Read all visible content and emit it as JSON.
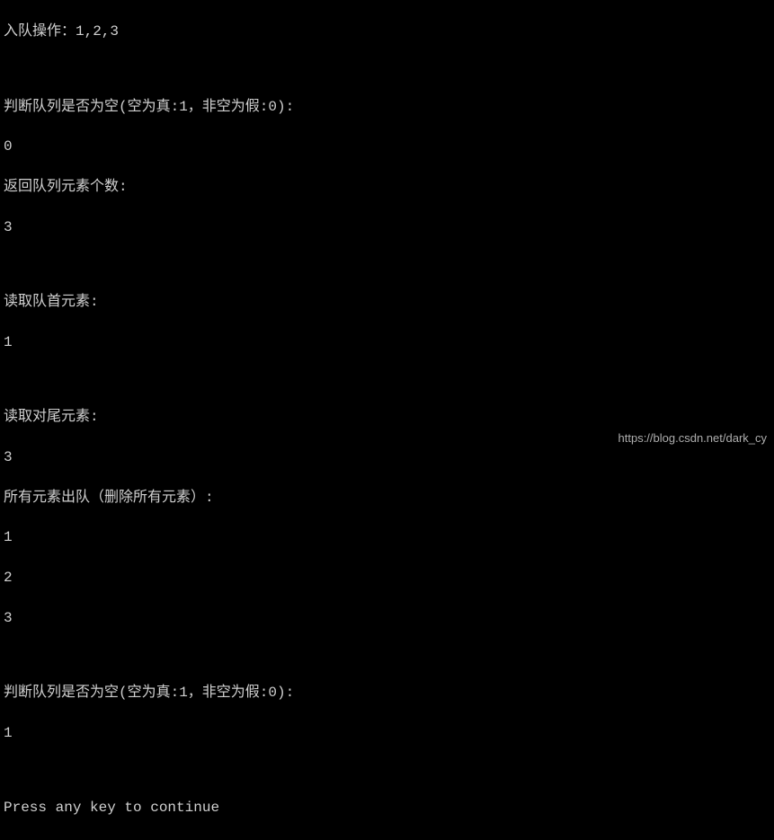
{
  "console": {
    "lines": [
      "入队操作：1,2,3",
      "",
      "判断队列是否为空(空为真:1，非空为假:0):",
      "0",
      "返回队列元素个数:",
      "3",
      "",
      "读取队首元素:",
      "1",
      "",
      "读取对尾元素:",
      "3",
      "所有元素出队（删除所有元素）:",
      "1",
      "2",
      "3",
      "",
      "判断队列是否为空(空为真:1，非空为假:0):",
      "1",
      "",
      "Press any key to continue"
    ]
  },
  "watermark": {
    "text": "https://blog.csdn.net/dark_cy"
  }
}
